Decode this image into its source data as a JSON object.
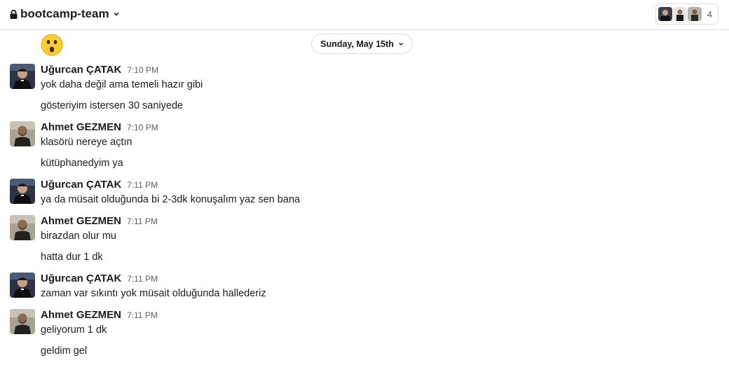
{
  "header": {
    "channel_name": "bootcamp-team",
    "lock_icon": "lock-icon",
    "dropdown_icon": "chevron-down-icon",
    "member_count": "4"
  },
  "date_divider": {
    "label": "Sunday, May 15th"
  },
  "emoji": "astonished-face-icon",
  "users": {
    "ugurcan": {
      "name": "Uğurcan ÇATAK"
    },
    "ahmet": {
      "name": "Ahmet GEZMEN"
    }
  },
  "messages": [
    {
      "author": "Uğurcan ÇATAK",
      "time": "7:10 PM",
      "lines": [
        "yok daha değil ama temeli hazır gibi",
        "gösteriyim istersen 30 saniyede"
      ]
    },
    {
      "author": "Ahmet GEZMEN",
      "time": "7:10 PM",
      "lines": [
        "klasörü nereye açtın",
        "kütüphanedyim ya"
      ]
    },
    {
      "author": "Uğurcan ÇATAK",
      "time": "7:11 PM",
      "lines": [
        "ya da müsait olduğunda bi 2-3dk konuşalım yaz sen bana"
      ]
    },
    {
      "author": "Ahmet GEZMEN",
      "time": "7:11 PM",
      "lines": [
        "birazdan olur mu",
        "hatta dur 1 dk"
      ]
    },
    {
      "author": "Uğurcan ÇATAK",
      "time": "7:11 PM",
      "lines": [
        "zaman var sıkıntı yok müsait olduğunda hallederiz"
      ]
    },
    {
      "author": "Ahmet GEZMEN",
      "time": "7:11 PM",
      "lines": [
        "geliyorum 1 dk",
        "geldim gel"
      ]
    }
  ],
  "colors": {
    "text": "#1d1c1d",
    "muted": "#616061",
    "border": "#dddddd",
    "emoji_yellow": "#ffcc33"
  }
}
